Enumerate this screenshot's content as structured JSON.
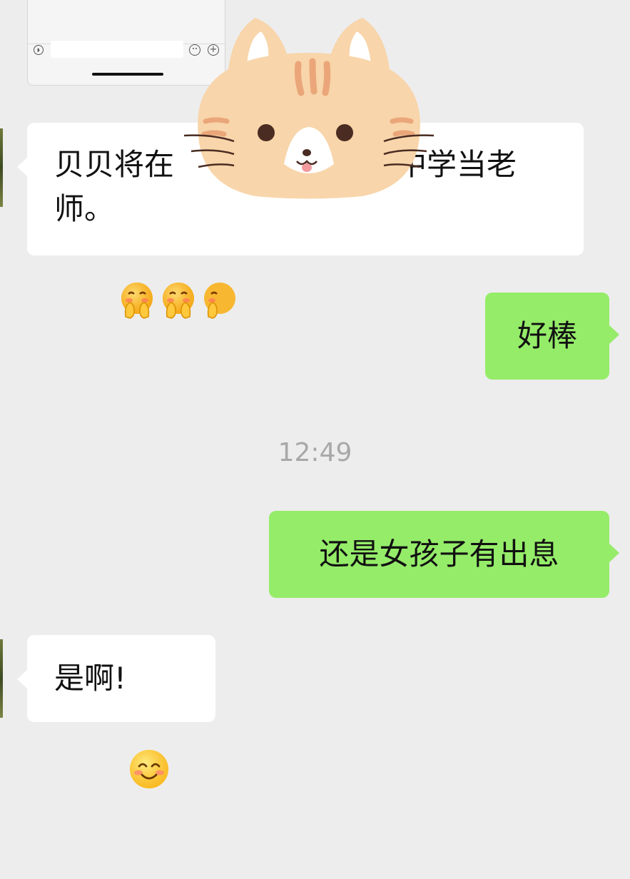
{
  "messages": [
    {
      "id": "msg1",
      "direction": "incoming",
      "text_before": "贝贝将在",
      "text_after": "中学当老",
      "text_line2": "师。",
      "emojis": [
        "covering-mouth-smile-emoji",
        "covering-mouth-smile-emoji",
        "covering-mouth-smile-emoji"
      ]
    },
    {
      "id": "msg2",
      "direction": "outgoing",
      "text": "好棒"
    },
    {
      "id": "msg3",
      "direction": "outgoing",
      "text": "还是女孩子有出息"
    },
    {
      "id": "msg4",
      "direction": "incoming",
      "text": "是啊!",
      "emojis": [
        "smiling-blush-emoji"
      ]
    }
  ],
  "timestamp": "12:49",
  "colors": {
    "background": "#ededed",
    "incoming_bubble": "#ffffff",
    "outgoing_bubble": "#95ec69",
    "timestamp": "#a8a8a8"
  },
  "overlay": {
    "sticker": "cat-face-privacy-sticker"
  }
}
